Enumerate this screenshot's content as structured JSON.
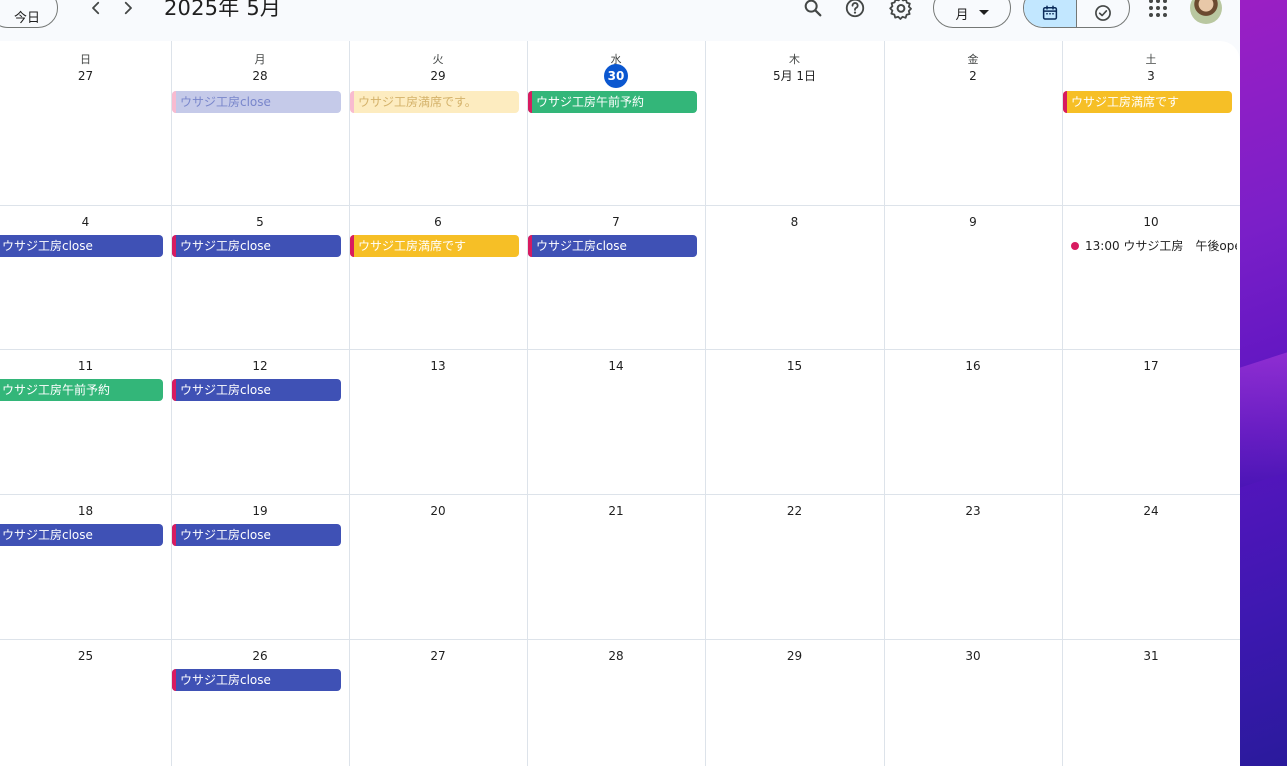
{
  "header": {
    "today_label": "今日",
    "title": "2025年 5月",
    "view_select_label": "月",
    "icons": [
      "chevron-left-icon",
      "chevron-right-icon",
      "search-icon",
      "help-icon",
      "gear-icon",
      "calendar-view-icon",
      "tasks-icon",
      "apps-icon"
    ]
  },
  "weekdays": [
    "日",
    "月",
    "火",
    "水",
    "木",
    "金",
    "土"
  ],
  "weeks": [
    [
      "27",
      "28",
      "29",
      "30",
      "5月 1日",
      "2",
      "3"
    ],
    [
      "4",
      "5",
      "6",
      "7",
      "8",
      "9",
      "10"
    ],
    [
      "11",
      "12",
      "13",
      "14",
      "15",
      "16",
      "17"
    ],
    [
      "18",
      "19",
      "20",
      "21",
      "22",
      "23",
      "24"
    ],
    [
      "25",
      "26",
      "27",
      "28",
      "29",
      "30",
      "31"
    ]
  ],
  "today_cell": {
    "week": 0,
    "day": 3
  },
  "events": [
    {
      "week": 0,
      "day": 1,
      "label": "ウサジ工房close",
      "bg": "#c5cae9",
      "edge": "#f8bbd0",
      "text": "#7986cb"
    },
    {
      "week": 0,
      "day": 2,
      "label": "ウサジ工房満席です。",
      "bg": "#fdecc0",
      "edge": "#f8bbd0",
      "text": "#d4b26a"
    },
    {
      "week": 0,
      "day": 3,
      "label": "ウサジ工房午前予約",
      "bg": "#33b679",
      "edge": "#d81b60",
      "text": "#ffffff"
    },
    {
      "week": 0,
      "day": 6,
      "label": "ウサジ工房満席です",
      "bg": "#f6bf26",
      "edge": "#d81b60",
      "text": "#ffffff"
    },
    {
      "week": 1,
      "day": 0,
      "label": "ウサジ工房close",
      "bg": "#3f51b5",
      "edge": "#3f51b5",
      "text": "#ffffff"
    },
    {
      "week": 1,
      "day": 1,
      "label": "ウサジ工房close",
      "bg": "#3f51b5",
      "edge": "#d81b60",
      "text": "#ffffff"
    },
    {
      "week": 1,
      "day": 2,
      "label": "ウサジ工房満席です",
      "bg": "#f6bf26",
      "edge": "#d81b60",
      "text": "#ffffff"
    },
    {
      "week": 1,
      "day": 3,
      "label": "ウサジ工房close",
      "bg": "#3f51b5",
      "edge": "#d81b60",
      "text": "#ffffff"
    },
    {
      "week": 2,
      "day": 0,
      "label": "ウサジ工房午前予約",
      "bg": "#33b679",
      "edge": "#33b679",
      "text": "#ffffff"
    },
    {
      "week": 2,
      "day": 1,
      "label": "ウサジ工房close",
      "bg": "#3f51b5",
      "edge": "#d81b60",
      "text": "#ffffff"
    },
    {
      "week": 3,
      "day": 0,
      "label": "ウサジ工房close",
      "bg": "#3f51b5",
      "edge": "#3f51b5",
      "text": "#ffffff"
    },
    {
      "week": 3,
      "day": 1,
      "label": "ウサジ工房close",
      "bg": "#3f51b5",
      "edge": "#d81b60",
      "text": "#ffffff"
    },
    {
      "week": 4,
      "day": 1,
      "label": "ウサジ工房close",
      "bg": "#3f51b5",
      "edge": "#d81b60",
      "text": "#ffffff"
    }
  ],
  "timed_events": [
    {
      "week": 1,
      "day": 6,
      "time": "13:00",
      "label": "ウサジ工房　午後open",
      "dot": "#d81b60"
    }
  ],
  "colors": {
    "accent_blue": "#0b57d0",
    "event_blue": "#3f51b5",
    "event_green": "#33b679",
    "event_yellow": "#f6bf26",
    "event_pink_edge": "#d81b60"
  }
}
